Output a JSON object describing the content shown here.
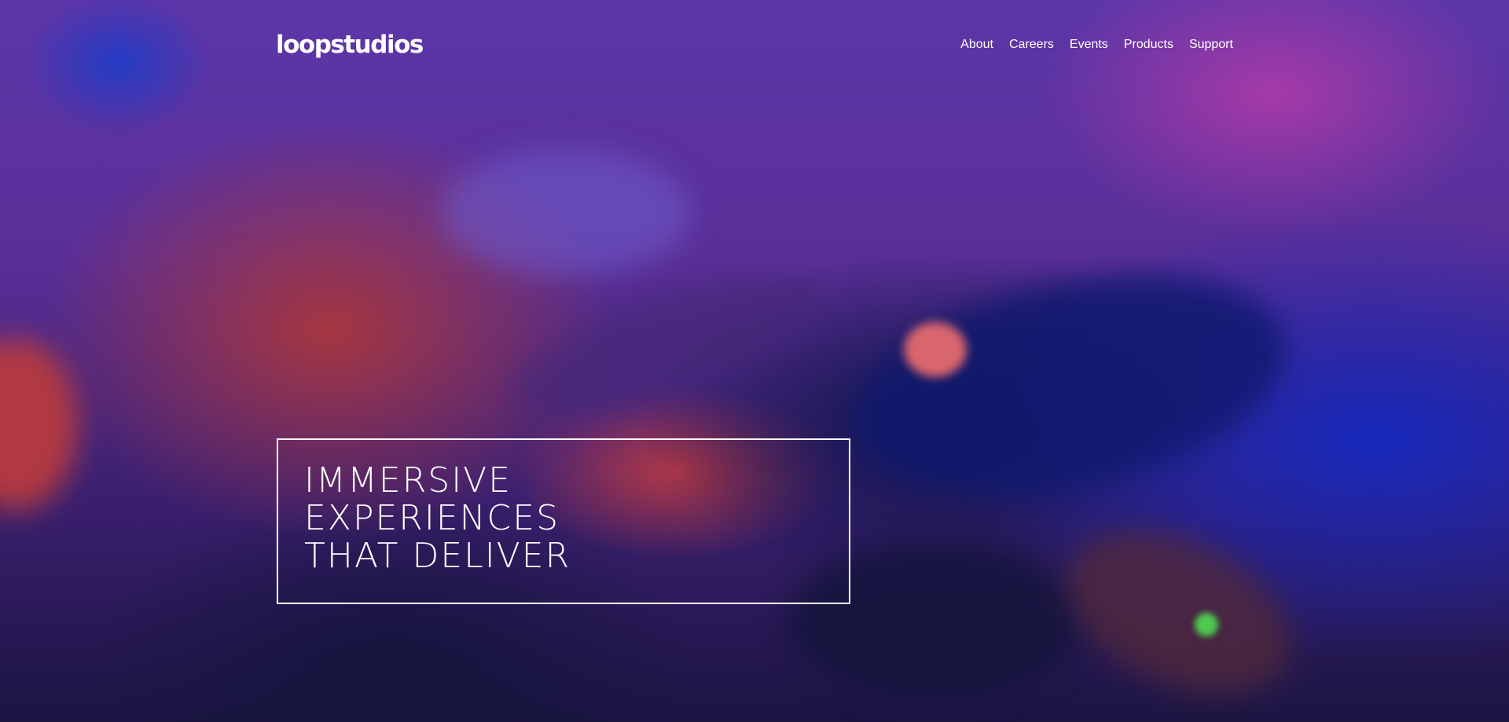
{
  "header": {
    "logo": "loopstudios",
    "nav": [
      {
        "label": "About"
      },
      {
        "label": "Careers"
      },
      {
        "label": "Events"
      },
      {
        "label": "Products"
      },
      {
        "label": "Support"
      }
    ]
  },
  "hero": {
    "headline_lines": [
      "IMMERSIVE",
      "EXPERIENCES",
      "THAT DELIVER"
    ],
    "colors": {
      "text": "#ffffff",
      "border": "#ffffff",
      "background_primary": "#5c36a8",
      "background_accent_red": "#aa373c",
      "background_accent_blue": "#1428be"
    }
  }
}
